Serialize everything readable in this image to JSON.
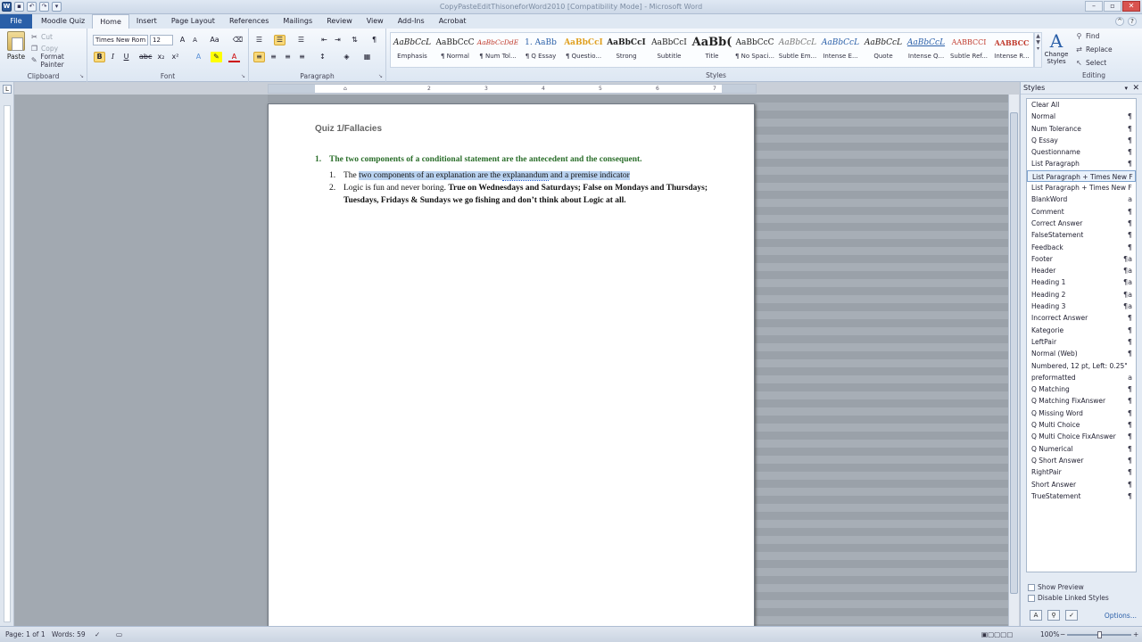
{
  "window": {
    "title": "CopyPasteEditThisoneforWord2010 [Compatibility Mode] - Microsoft Word"
  },
  "tabs": {
    "file": "File",
    "items": [
      "Moodle Quiz",
      "Home",
      "Insert",
      "Page Layout",
      "References",
      "Mailings",
      "Review",
      "View",
      "Add-Ins",
      "Acrobat"
    ]
  },
  "clipboard": {
    "paste": "Paste",
    "cut": "Cut",
    "copy": "Copy",
    "format_painter": "Format Painter",
    "label": "Clipboard"
  },
  "font": {
    "name": "Times New Rom",
    "size": "12",
    "label": "Font"
  },
  "paragraph": {
    "label": "Paragraph"
  },
  "styles_gallery": {
    "label": "Styles",
    "items": [
      {
        "preview": "AaBbCcL",
        "name": "Emphasis"
      },
      {
        "preview": "AaBbCcC",
        "name": "¶ Normal"
      },
      {
        "preview": "AaBbCcDdE",
        "name": "¶ Num Tol..."
      },
      {
        "preview": "1. AaBb",
        "name": "¶ Q Essay"
      },
      {
        "preview": "AaBbCcI",
        "name": "¶ Questio..."
      },
      {
        "preview": "AaBbCcI",
        "name": "Strong"
      },
      {
        "preview": "AaBbCcI",
        "name": "Subtitle"
      },
      {
        "preview": "AaBb(",
        "name": "Title"
      },
      {
        "preview": "AaBbCcC",
        "name": "¶ No Spaci..."
      },
      {
        "preview": "AaBbCcL",
        "name": "Subtle Em..."
      },
      {
        "preview": "AaBbCcL",
        "name": "Intense E..."
      },
      {
        "preview": "AaBbCcL",
        "name": "Quote"
      },
      {
        "preview": "AaBbCcL",
        "name": "Intense Q..."
      },
      {
        "preview": "AABBCCI",
        "name": "Subtle Ref..."
      },
      {
        "preview": "AABBCC",
        "name": "Intense R..."
      }
    ],
    "change_styles": "Change Styles"
  },
  "editing": {
    "find": "Find",
    "replace": "Replace",
    "select": "Select",
    "label": "Editing"
  },
  "document": {
    "heading": "Quiz 1/Fallacies",
    "q1_num": "1.",
    "q1_text": "The two components of a conditional statement are the antecedent and the consequent.",
    "sub1_num": "1.",
    "sub1_pre": "The ",
    "sub1_sel_a": "two components of an explanation are the ",
    "sub1_sel_b": "explanandum",
    "sub1_sel_c": " and a premise indicator",
    "sub2_num": "2.",
    "sub2_normal": "Logic is fun and never boring.  ",
    "sub2_bold": "True on Wednesdays and Saturdays; False on Mondays and Thursdays; Tuesdays, Fridays & Sundays we go fishing and don’t think about Logic at all."
  },
  "styles_pane": {
    "title": "Styles",
    "items": [
      {
        "name": "Clear All",
        "mark": ""
      },
      {
        "name": "Normal",
        "mark": "¶"
      },
      {
        "name": "Num Tolerance",
        "mark": "¶"
      },
      {
        "name": "Q Essay",
        "mark": "¶"
      },
      {
        "name": "Questionname",
        "mark": "¶"
      },
      {
        "name": "List Paragraph",
        "mark": "¶"
      },
      {
        "name": "List Paragraph + Times New F",
        "mark": ""
      },
      {
        "name": "List Paragraph + Times New F",
        "mark": ""
      },
      {
        "name": "BlankWord",
        "mark": "a"
      },
      {
        "name": "Comment",
        "mark": "¶"
      },
      {
        "name": "Correct Answer",
        "mark": "¶"
      },
      {
        "name": "FalseStatement",
        "mark": "¶"
      },
      {
        "name": "Feedback",
        "mark": "¶"
      },
      {
        "name": "Footer",
        "mark": "¶a"
      },
      {
        "name": "Header",
        "mark": "¶a"
      },
      {
        "name": "Heading 1",
        "mark": "¶a"
      },
      {
        "name": "Heading 2",
        "mark": "¶a"
      },
      {
        "name": "Heading 3",
        "mark": "¶a"
      },
      {
        "name": "Incorrect Answer",
        "mark": "¶"
      },
      {
        "name": "Kategorie",
        "mark": "¶"
      },
      {
        "name": "LeftPair",
        "mark": "¶"
      },
      {
        "name": "Normal (Web)",
        "mark": "¶"
      },
      {
        "name": "Numbered, 12 pt, Left:  0.25\"",
        "mark": ""
      },
      {
        "name": "preformatted",
        "mark": "a"
      },
      {
        "name": "Q Matching",
        "mark": "¶"
      },
      {
        "name": "Q Matching FixAnswer",
        "mark": "¶"
      },
      {
        "name": "Q Missing Word",
        "mark": "¶"
      },
      {
        "name": "Q Multi Choice",
        "mark": "¶"
      },
      {
        "name": "Q Multi Choice FixAnswer",
        "mark": "¶"
      },
      {
        "name": "Q Numerical",
        "mark": "¶"
      },
      {
        "name": "Q Short Answer",
        "mark": "¶"
      },
      {
        "name": "RightPair",
        "mark": "¶"
      },
      {
        "name": "Short Answer",
        "mark": "¶"
      },
      {
        "name": "TrueStatement",
        "mark": "¶"
      }
    ],
    "show_preview": "Show Preview",
    "disable_linked": "Disable Linked Styles",
    "options": "Options..."
  },
  "status": {
    "page": "Page: 1 of 1",
    "words": "Words: 59",
    "zoom": "100%"
  }
}
